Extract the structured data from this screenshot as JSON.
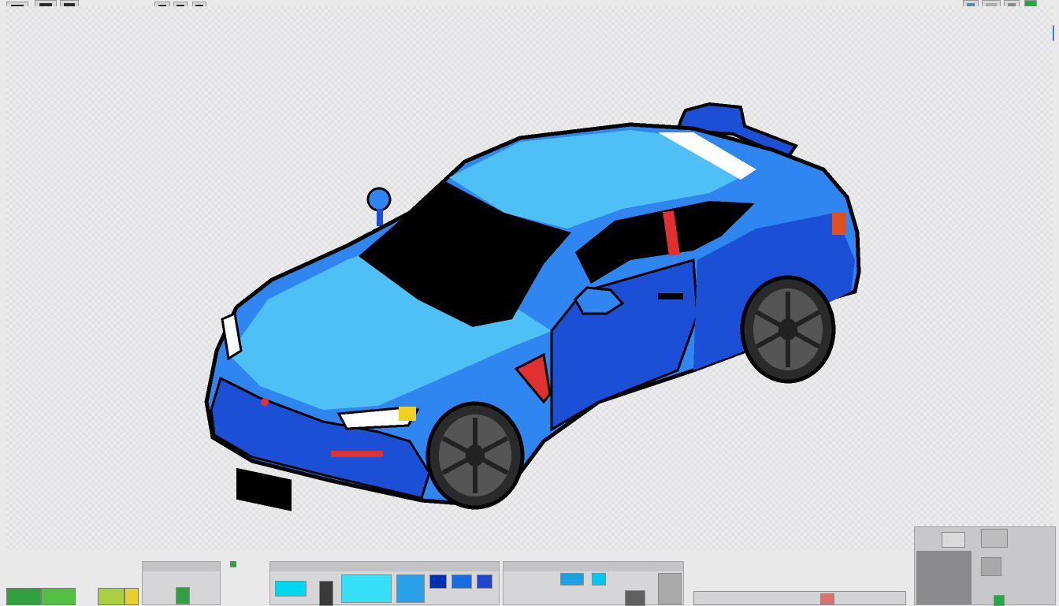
{
  "app": {
    "accent": "#2a6fe0",
    "background": "#e9e9ea"
  },
  "toolbar_left": {
    "buttons": [
      {
        "name": "file-icon"
      },
      {
        "name": "image-icon"
      },
      {
        "name": "window-icon"
      },
      {
        "name": "settings-icon"
      },
      {
        "name": "layer-icon"
      },
      {
        "name": "pencil-icon"
      },
      {
        "name": "frame-icon"
      }
    ]
  },
  "toolbar_right": {
    "buttons": [
      {
        "name": "frame-icon"
      },
      {
        "name": "image-icon"
      },
      {
        "name": "grid-icon"
      },
      {
        "name": "green-toggle-icon"
      },
      {
        "name": "yellow-color-icon"
      },
      {
        "name": "layer-icon"
      },
      {
        "name": "blue-color-icon"
      }
    ]
  },
  "canvas": {
    "sprite_colors": {
      "outline": "#000000",
      "body_dark": "#1a4fd6",
      "body_mid": "#2f86f0",
      "body_light": "#4fc0f5",
      "highlight": "#ffffff",
      "glass": "#000000",
      "tire": "#2a2a2a",
      "rim": "#555555",
      "brake_light": "#e03030",
      "signal": "#f0d020"
    }
  },
  "palette_bar": {
    "swatches": [
      "#30a040",
      "#52c040",
      "#a8d040",
      "#e8d030"
    ]
  },
  "color_panels": {
    "panel_1": {
      "cells": [
        "#00d8f0",
        "#3a3a3a",
        "#35e0f8",
        "#29a0e8",
        "#0030b0",
        "#1b6be0",
        "#2244cc"
      ]
    },
    "panel_2": {
      "cells": [
        "#1ea0e0",
        "#00c8f0",
        "#606060",
        "#aaaaaa"
      ]
    }
  }
}
